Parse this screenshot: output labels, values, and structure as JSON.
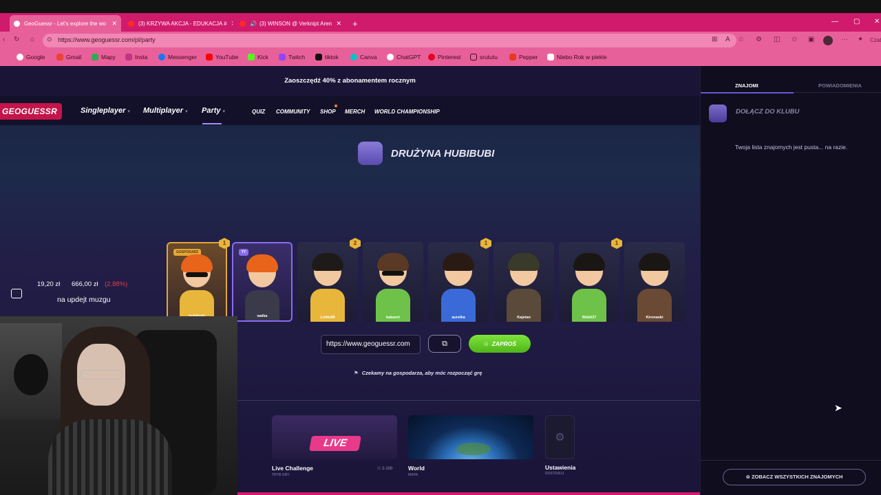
{
  "browser": {
    "tabs": [
      {
        "title": "GeoGuessr - Let's explore the wo",
        "active": true
      },
      {
        "title": "(3) KRZYWA AKCJA - EDUKACJA #",
        "active": false
      },
      {
        "title": "(3) WINSON @ Verknipt Aren",
        "active": false
      }
    ],
    "new_tab": "+",
    "url": "https://www.geoguessr.com/pl/party",
    "bookmarks": [
      "Google",
      "Gmail",
      "Mapy",
      "Insta",
      "Messenger",
      "YouTube",
      "Kick",
      "Twitch",
      "tiktok",
      "Canva",
      "ChatGPT",
      "Pinterest",
      "srututu",
      "Pepper",
      "Niebo Rok w piekle"
    ],
    "profile_label": "Czat"
  },
  "site": {
    "promo": "Zaoszczędź 40% z abonamentem rocznym",
    "logo": "GEOGUESSR",
    "nav": {
      "singleplayer": "Singleplayer",
      "multiplayer": "Multiplayer",
      "party": "Party",
      "quiz": "QUIZ",
      "community": "COMMUNITY",
      "shop": "SHOP",
      "merch": "MERCH",
      "championship": "WORLD CHAMPIONSHIP"
    }
  },
  "party": {
    "team_name": "DRUŻYNA HUBIBUBI",
    "host_tag": "GOSPODARZ",
    "me_tag": "TY",
    "players": [
      {
        "name": "hubibubi",
        "badge": "1",
        "hair": "#e8641a",
        "shirt": "#e8b63a",
        "glasses": true
      },
      {
        "name": "walka",
        "badge": "",
        "hair": "#e8641a",
        "shirt": "#3a3a4a",
        "glasses": false
      },
      {
        "name": "Lolito98",
        "badge": "2",
        "hair": "#1e1a18",
        "shirt": "#e8b63a",
        "glasses": false
      },
      {
        "name": "kakazet",
        "badge": "",
        "hair": "#5a3a24",
        "shirt": "#6ec24a",
        "glasses": true
      },
      {
        "name": "aurelka",
        "badge": "1",
        "hair": "#2a1a14",
        "shirt": "#3a6ad8",
        "glasses": false
      },
      {
        "name": "Kajetan",
        "badge": "",
        "hair": "#3a3a2a",
        "shirt": "#5a4a3a",
        "glasses": false
      },
      {
        "name": "Waldi37",
        "badge": "1",
        "hair": "#1a1614",
        "shirt": "#6ec24a",
        "glasses": false
      },
      {
        "name": "Kironaski",
        "badge": "",
        "hair": "#1a1614",
        "shirt": "#6a4a34",
        "glasses": false
      }
    ],
    "invite_url": "https://www.geoguessr.com",
    "invite_button": "ZAPROŚ",
    "waiting_text": "Czekamy na gospodarza, aby móc rozpocząć grę",
    "modes": [
      {
        "title": "Live Challenge",
        "subtitle": "TRYB GRY",
        "meta": "2-100"
      },
      {
        "title": "World",
        "subtitle": "MAPA"
      },
      {
        "title": "Ustawienia",
        "subtitle": "DOSTOSUJ"
      }
    ],
    "live_tag": "LIVE"
  },
  "overlay": {
    "raised": "19,20 zł",
    "goal": "666,00 zł",
    "percent": "(2.88%)",
    "goal_label": "na updejt muzgu"
  },
  "friends": {
    "tab_friends": "ZNAJOMI",
    "tab_notifications": "POWIADOMIENIA",
    "club_label": "DOŁĄCZ DO KLUBU",
    "empty_text": "Twoja lista znajomych jest pusta... na razie.",
    "see_all": "ZOBACZ WSZYSTKICH ZNAJOMYCH"
  },
  "colors": {
    "brand": "#c4154b",
    "browser_accent": "#e8609a",
    "invite": "#4fb51a"
  }
}
